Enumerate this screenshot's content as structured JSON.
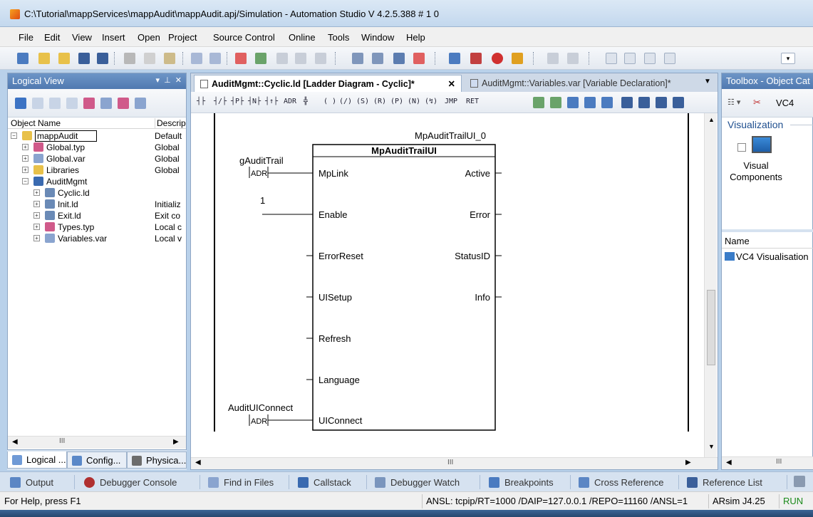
{
  "window": {
    "title": "C:\\Tutorial\\mappServices\\mappAudit\\mappAudit.apj/Simulation - Automation Studio V 4.2.5.388 # 1 0"
  },
  "menu": [
    "File",
    "Edit",
    "View",
    "Insert",
    "Open",
    "Project",
    "Source Control",
    "Online",
    "Tools",
    "Window",
    "Help"
  ],
  "logical_view": {
    "title": "Logical View",
    "col_name": "Object Name",
    "col_desc": "Descrip",
    "items": [
      {
        "name": "mappAudit",
        "desc": "Default",
        "level": 0,
        "expander": "−",
        "selected": true
      },
      {
        "name": "Global.typ",
        "desc": "Global",
        "level": 1,
        "expander": "+"
      },
      {
        "name": "Global.var",
        "desc": "Global",
        "level": 1,
        "expander": "+"
      },
      {
        "name": "Libraries",
        "desc": "Global",
        "level": 1,
        "expander": "+"
      },
      {
        "name": "AuditMgmt",
        "desc": "",
        "level": 1,
        "expander": "−"
      },
      {
        "name": "Cyclic.ld",
        "desc": "",
        "level": 2,
        "expander": "+"
      },
      {
        "name": "Init.ld",
        "desc": "Initializ",
        "level": 2,
        "expander": "+"
      },
      {
        "name": "Exit.ld",
        "desc": "Exit co",
        "level": 2,
        "expander": "+"
      },
      {
        "name": "Types.typ",
        "desc": "Local c",
        "level": 2,
        "expander": "+"
      },
      {
        "name": "Variables.var",
        "desc": "Local v",
        "level": 2,
        "expander": "+"
      }
    ],
    "scroll_mark": "III",
    "tabs": [
      "Logical ...",
      "Config...",
      "Physica..."
    ]
  },
  "editor": {
    "tabs": [
      {
        "label": "AuditMgmt::Cyclic.ld [Ladder Diagram - Cyclic]*",
        "close": "✕",
        "active": true
      },
      {
        "label": "AuditMgmt::Variables.var [Variable Declaration]*",
        "active": false
      }
    ],
    "toolbar_symbols": [
      "┤├",
      "┤/├",
      "┤P├",
      "┤N├",
      "┤↑├",
      "ADR",
      "╬",
      "( )",
      "(/)",
      "(S)",
      "(R)",
      "(P)",
      "(N)",
      "(↯)",
      "JMP",
      "RET"
    ],
    "fb": {
      "instance": "MpAuditTrailUI_0",
      "type": "MpAuditTrailUI",
      "inputs": [
        "MpLink",
        "Enable",
        "ErrorReset",
        "UISetup",
        "Refresh",
        "Language",
        "UIConnect"
      ],
      "outputs": [
        "Active",
        "Error",
        "StatusID",
        "Info"
      ],
      "var_gaudit": "gAuditTrail",
      "adr_label": "ADR",
      "enable_const": "1",
      "var_uiconnect": "AuditUIConnect"
    },
    "hscroll_mark": "III"
  },
  "toolbox": {
    "title": "Toolbox - Object Cat",
    "filter": "VC4",
    "group": "Visualization",
    "item_label": "Visual Components",
    "list_header": "Name",
    "list_item": "VC4 Visualisation",
    "scroll_mark": "III"
  },
  "bottom_tabs": [
    "Output",
    "Debugger Console",
    "Find in Files",
    "Callstack",
    "Debugger Watch",
    "Breakpoints",
    "Cross Reference",
    "Reference List"
  ],
  "status": {
    "help": "For Help, press F1",
    "connection": "ANSL: tcpip/RT=1000 /DAIP=127.0.0.1 /REPO=11160 /ANSL=1",
    "target": "ARsim  J4.25",
    "state": "RUN"
  }
}
